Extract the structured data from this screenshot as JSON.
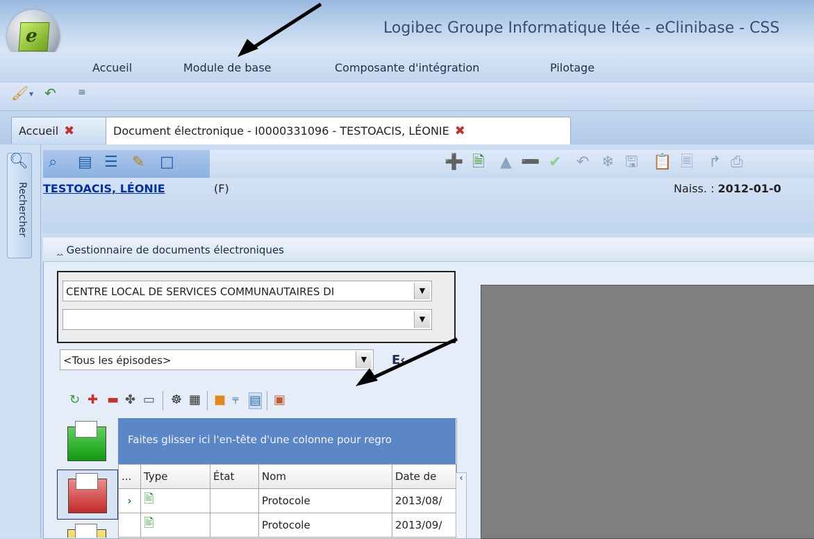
{
  "window": {
    "title": "Logibec Groupe Informatique ltée - eClinibase - CSS",
    "logo_letter": "e"
  },
  "menu": {
    "items": [
      "Accueil",
      "Module de base",
      "Composante d'intégration",
      "Pilotage"
    ]
  },
  "tabs": [
    {
      "label": "Accueil"
    },
    {
      "label": "Document électronique - I0000331096 - TESTOACIS, LÉONIE"
    }
  ],
  "sidebar": {
    "rechercher_label": "Rechercher"
  },
  "patient": {
    "name": "TESTOACIS, LÉONIE",
    "sex": "(F)",
    "birth_label": "Naiss. : ",
    "birth_value": "2012-01-0"
  },
  "gestionnaire": {
    "title": "Gestionnaire de documents électroniques",
    "establishment_value": "CENTRE LOCAL DE SERVICES COMMUNAUTAIRES DI",
    "second_select_value": "",
    "episodes_value": "<Tous les épisodes>",
    "ec_label": "E‹"
  },
  "grid": {
    "group_hint": "Faites glisser ici l'en-tête d'une colonne pour regro",
    "columns": [
      "...",
      "Type",
      "État",
      "Nom",
      "Date de"
    ],
    "rows": [
      {
        "indicator": "›",
        "etat": "",
        "nom": "Protocole",
        "date": "2013/08/"
      },
      {
        "indicator": "",
        "etat": "",
        "nom": "Protocole",
        "date": "2013/09/"
      }
    ]
  },
  "colors": {
    "accent": "#5b87c9",
    "link": "#002fa8",
    "preview_bg": "#7f7f7f"
  }
}
